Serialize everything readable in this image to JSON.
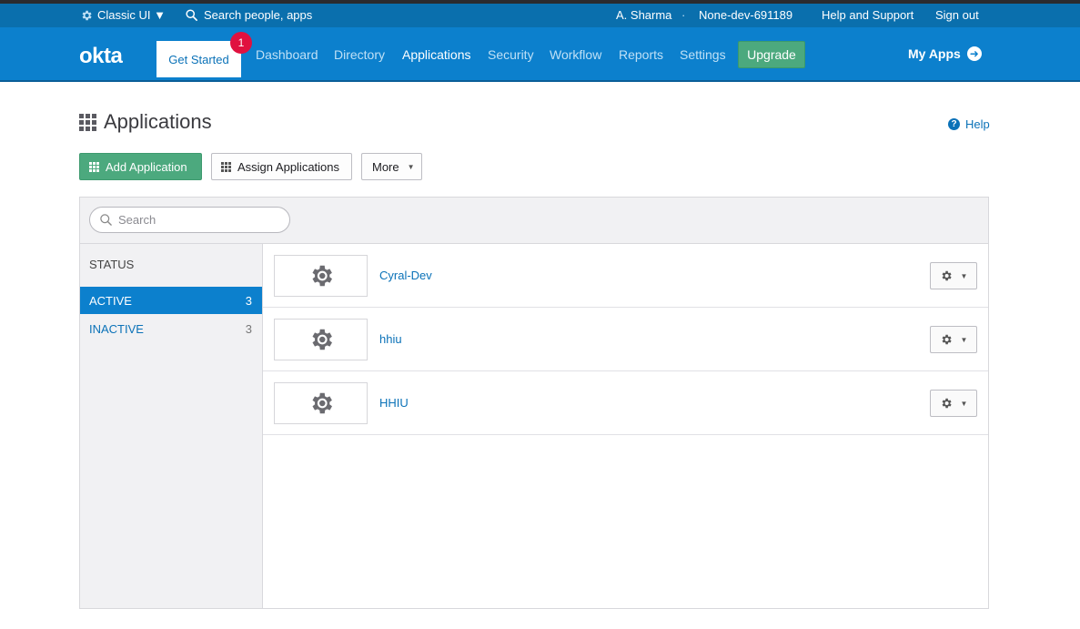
{
  "utility_bar": {
    "classic_ui": "Classic UI ▼",
    "search": "Search people, apps",
    "user": "A. Sharma",
    "separator": "·",
    "org": "None-dev-691189",
    "help_support": "Help and Support",
    "sign_out": "Sign out"
  },
  "nav": {
    "logo": "okta",
    "get_started": "Get Started",
    "get_started_badge": "1",
    "links": [
      "Dashboard",
      "Directory",
      "Applications",
      "Security",
      "Workflow",
      "Reports",
      "Settings"
    ],
    "active_link": "Applications",
    "upgrade": "Upgrade",
    "my_apps": "My Apps"
  },
  "page": {
    "title": "Applications",
    "help": "Help"
  },
  "toolbar": {
    "add_application": "Add Application",
    "assign_applications": "Assign Applications",
    "more": "More"
  },
  "search": {
    "placeholder": "Search"
  },
  "sidebar": {
    "heading": "STATUS",
    "items": [
      {
        "label": "ACTIVE",
        "count": "3"
      },
      {
        "label": "INACTIVE",
        "count": "3"
      }
    ]
  },
  "apps": [
    {
      "name": "Cyral-Dev"
    },
    {
      "name": "hhiu"
    },
    {
      "name": "HHIU"
    }
  ],
  "colors": {
    "brand_blue": "#0c80cd",
    "utility_blue": "#0a6fad",
    "green": "#4ca97e",
    "badge_red": "#e0113f"
  }
}
